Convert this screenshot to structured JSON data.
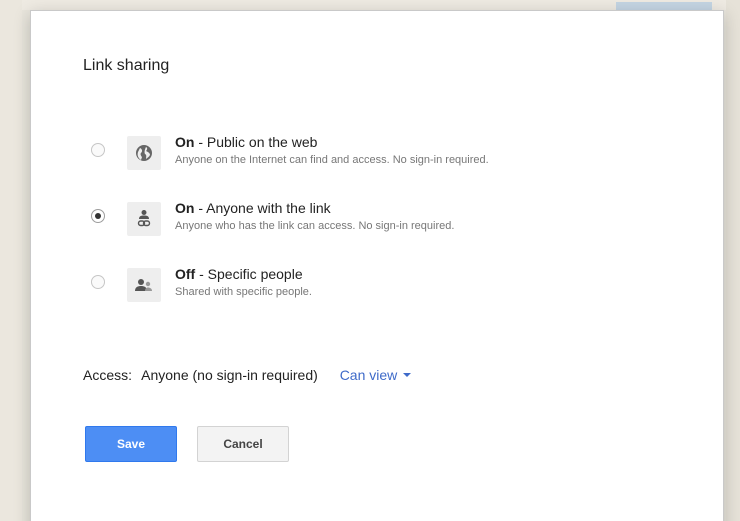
{
  "dialog": {
    "title": "Link sharing"
  },
  "options": [
    {
      "state": "On",
      "label": " - Public on the web",
      "description": "Anyone on the Internet can find and access. No sign-in required.",
      "icon": "globe-icon",
      "selected": false
    },
    {
      "state": "On",
      "label": " - Anyone with the link",
      "description": "Anyone who has the link can access. No sign-in required.",
      "icon": "person-link-icon",
      "selected": true
    },
    {
      "state": "Off",
      "label": " - Specific people",
      "description": "Shared with specific people.",
      "icon": "people-icon",
      "selected": false
    }
  ],
  "access": {
    "prefix": "Access:",
    "who": "Anyone (no sign-in required)",
    "permission": "Can view"
  },
  "buttons": {
    "save": "Save",
    "cancel": "Cancel"
  },
  "colors": {
    "accent_link": "#3e6ac9",
    "primary_button": "#4d8ef4"
  }
}
